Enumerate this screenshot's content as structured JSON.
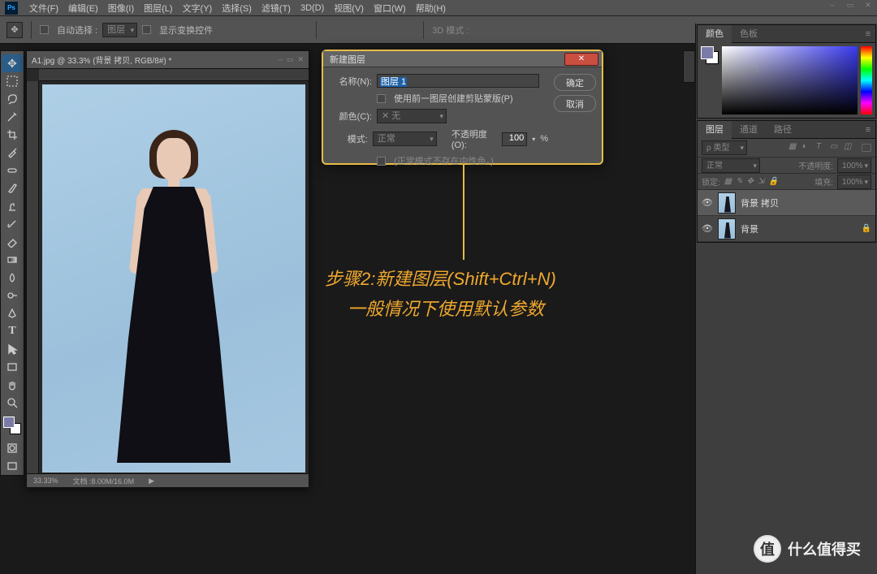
{
  "menu": {
    "items": [
      "文件(F)",
      "编辑(E)",
      "图像(I)",
      "图层(L)",
      "文字(Y)",
      "选择(S)",
      "滤镜(T)",
      "3D(D)",
      "视图(V)",
      "窗口(W)",
      "帮助(H)"
    ]
  },
  "options": {
    "auto_select": "自动选择 :",
    "layer_dd": "图层",
    "show_transform": "显示变换控件",
    "mode3d": "3D 模式 :"
  },
  "doc": {
    "tab_title": "A1.jpg @ 33.3% (背景 拷贝, RGB/8#) *",
    "zoom": "33.33%",
    "status": "文档 :8.00M/16.0M"
  },
  "dialog": {
    "title": "新建图层",
    "name_lbl": "名称(N):",
    "name_val": "图层 1",
    "clip_chk": "使用前一图层创建剪贴蒙版(P)",
    "color_lbl": "颜色(C):",
    "color_val": "✕ 无",
    "mode_lbl": "模式:",
    "mode_val": "正常",
    "opacity_lbl": "不透明度(O):",
    "opacity_val": "100",
    "opacity_pct": "%",
    "neutral": "(正常模式不存在中性色。)",
    "ok": "确定",
    "cancel": "取消"
  },
  "annotation": {
    "line1": "步骤2:新建图层(Shift+Ctrl+N)",
    "line2": "一般情况下使用默认参数"
  },
  "panels": {
    "color_tabs": [
      "颜色",
      "色板"
    ],
    "layer_tabs": [
      "图层",
      "通道",
      "路径"
    ],
    "kind": "ρ 类型",
    "blend": "正常",
    "opacity_lbl": "不透明度:",
    "opacity": "100%",
    "lock_lbl": "锁定:",
    "fill_lbl": "填充:",
    "fill": "100%",
    "layers": [
      {
        "name": "背景 拷贝",
        "locked": false
      },
      {
        "name": "背景",
        "locked": true
      }
    ]
  },
  "watermark": "什么值得买"
}
